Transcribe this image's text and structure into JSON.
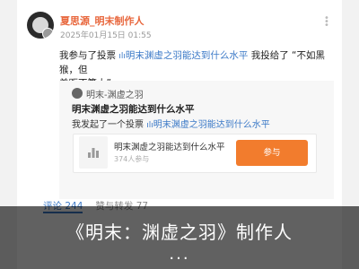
{
  "post": {
    "username": "夏思源_明末制作人",
    "date": "2025年01月15日 01:55",
    "text_prefix": "我参与了投票",
    "poll_link": "明末渊虚之羽能达到什么水平",
    "text_suffix_line1": " 我投给了 “不如黑猴，但",
    "text_line2": "差距不算大”"
  },
  "repost": {
    "author": "明末-渊虚之羽",
    "title": "明末渊虚之羽能达到什么水平",
    "text_prefix": "我发起了一个投票",
    "poll_link": "明末渊虚之羽能达到什么水平",
    "poll": {
      "title": "明末渊虚之羽能达到什么水平",
      "count": "374人参与",
      "button": "参与"
    }
  },
  "tabs": {
    "comments": "评论 244",
    "reposts": "赞与转发 77"
  },
  "caption": {
    "text": "《明末：渊虚之羽》制作人",
    "ellipsis": "..."
  },
  "colors": {
    "accent": "#f27c2d",
    "link": "#3b79c7",
    "username": "#e8673d"
  }
}
